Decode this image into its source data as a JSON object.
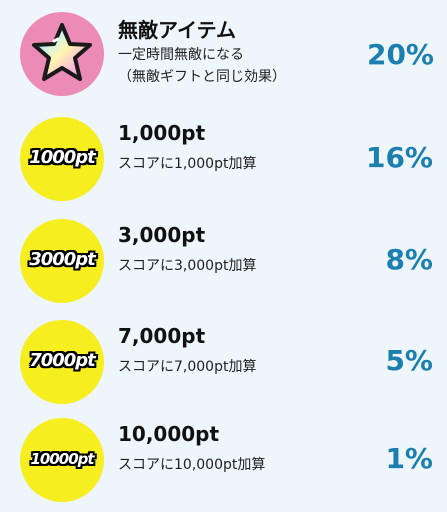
{
  "colors": {
    "background": "#eef5fb",
    "rate_text": "#1b7fb0",
    "badge_pink": "#ec8bb5",
    "badge_yellow": "#f6ee1e"
  },
  "items": [
    {
      "icon": "rainbow-star-icon",
      "title": "無敵アイテム",
      "desc_line1": "一定時間無敵になる",
      "desc_line2": "（無敵ギフトと同じ効果）",
      "rate": "20%"
    },
    {
      "icon": "points-badge-icon",
      "badge_text": "1000pt",
      "title": "1,000pt",
      "desc_line1": "スコアに1,000pt加算",
      "rate": "16%"
    },
    {
      "icon": "points-badge-icon",
      "badge_text": "3000pt",
      "title": "3,000pt",
      "desc_line1": "スコアに3,000pt加算",
      "rate": "8%"
    },
    {
      "icon": "points-badge-icon",
      "badge_text": "7000pt",
      "title": "7,000pt",
      "desc_line1": "スコアに7,000pt加算",
      "rate": "5%"
    },
    {
      "icon": "points-badge-icon",
      "badge_text": "10000pt",
      "title": "10,000pt",
      "desc_line1": "スコアに10,000pt加算",
      "rate": "1%"
    }
  ]
}
